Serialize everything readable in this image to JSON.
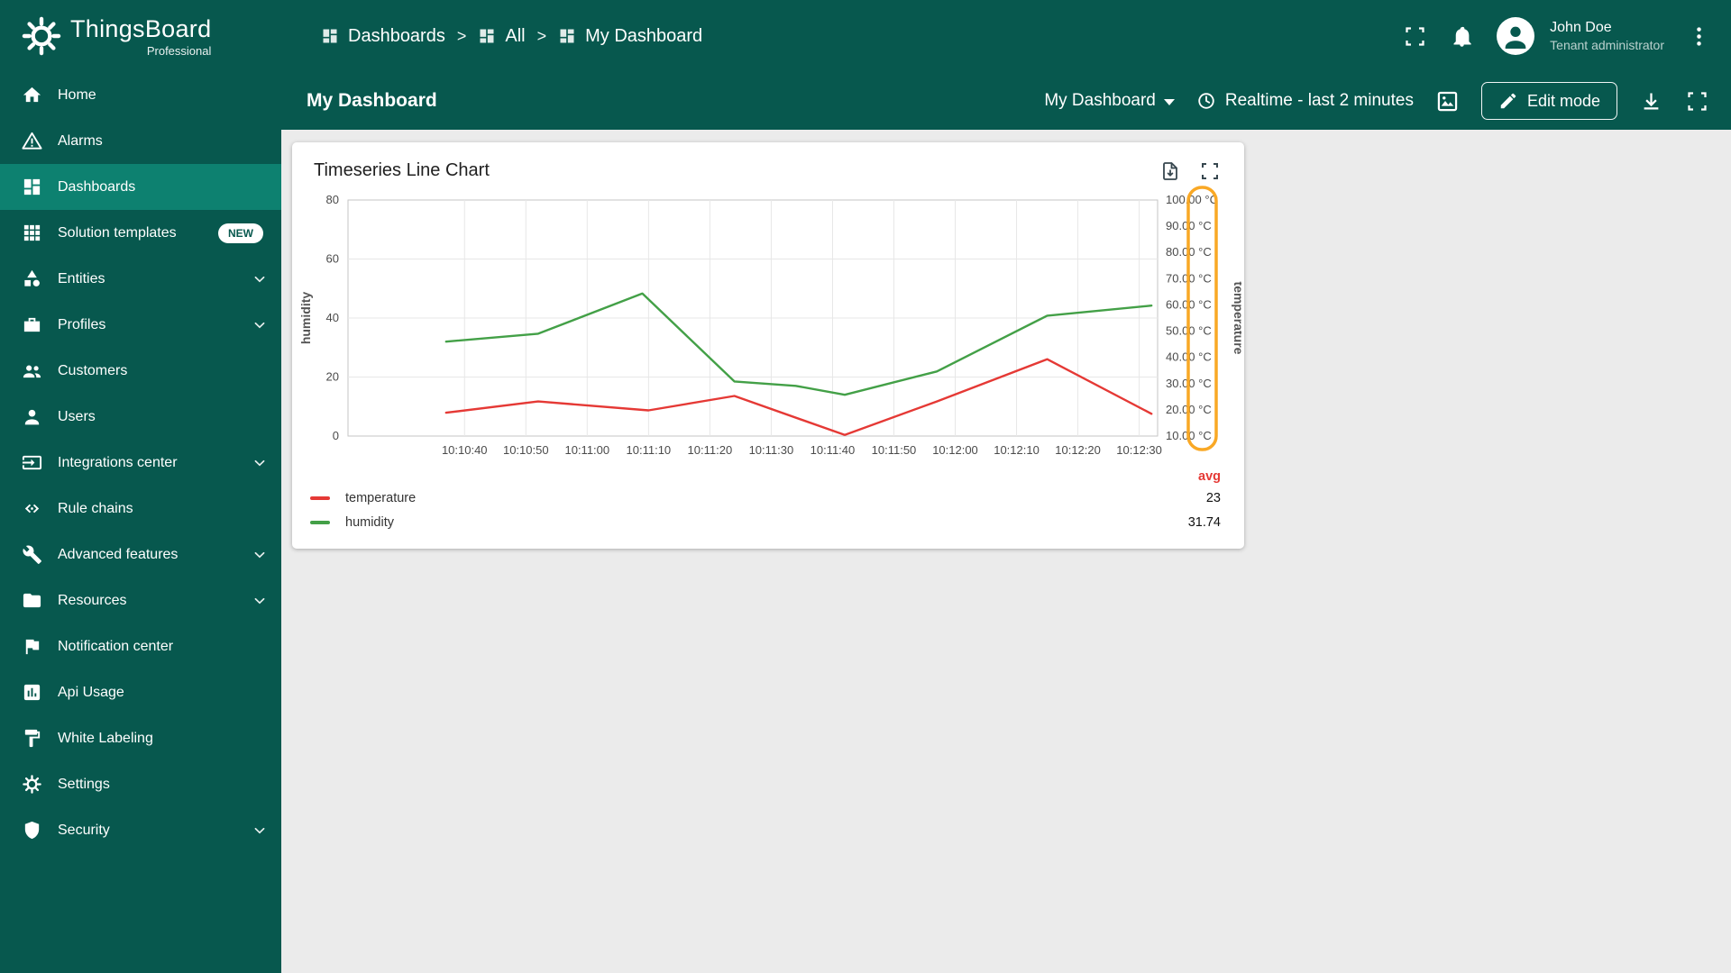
{
  "app": {
    "name": "ThingsBoard",
    "edition": "Professional"
  },
  "colors": {
    "primary": "#07584e",
    "active_item": "#0d8170",
    "highlight": "#f9a825",
    "avg_header": "#e53935"
  },
  "sidebar": {
    "items": [
      {
        "label": "Home",
        "icon": "home"
      },
      {
        "label": "Alarms",
        "icon": "warning"
      },
      {
        "label": "Dashboards",
        "icon": "dashboard",
        "active": true
      },
      {
        "label": "Solution templates",
        "icon": "apps",
        "badge": "NEW"
      },
      {
        "label": "Entities",
        "icon": "category",
        "expandable": true
      },
      {
        "label": "Profiles",
        "icon": "briefcase",
        "expandable": true
      },
      {
        "label": "Customers",
        "icon": "people"
      },
      {
        "label": "Users",
        "icon": "person"
      },
      {
        "label": "Integrations center",
        "icon": "input",
        "expandable": true
      },
      {
        "label": "Rule chains",
        "icon": "rule-chain"
      },
      {
        "label": "Advanced features",
        "icon": "build",
        "expandable": true
      },
      {
        "label": "Resources",
        "icon": "folder",
        "expandable": true
      },
      {
        "label": "Notification center",
        "icon": "flag"
      },
      {
        "label": "Api Usage",
        "icon": "chart-box"
      },
      {
        "label": "White Labeling",
        "icon": "paint"
      },
      {
        "label": "Settings",
        "icon": "gear"
      },
      {
        "label": "Security",
        "icon": "shield",
        "expandable": true
      }
    ]
  },
  "breadcrumb": {
    "separator": ">",
    "items": [
      {
        "label": "Dashboards",
        "icon": "dashboard"
      },
      {
        "label": "All",
        "icon": "dashboard"
      },
      {
        "label": "My Dashboard",
        "icon": "dashboard"
      }
    ]
  },
  "topbar": {
    "user": {
      "name": "John Doe",
      "role": "Tenant administrator"
    },
    "action_icons": [
      "fullscreen",
      "bell",
      "dots"
    ]
  },
  "toolbar": {
    "title": "My Dashboard",
    "dashboard_select": "My Dashboard",
    "timewindow": "Realtime - last 2 minutes",
    "edit_button": "Edit mode",
    "action_icons": [
      "image",
      "download",
      "fullscreen"
    ]
  },
  "widget": {
    "title": "Timeseries Line Chart",
    "action_icons": [
      "export-file",
      "fullscreen"
    ]
  },
  "chart_data": {
    "type": "line",
    "title": "Timeseries Line Chart",
    "x_ticks": [
      "10:10:40",
      "10:10:50",
      "10:11:00",
      "10:11:10",
      "10:11:20",
      "10:11:30",
      "10:11:40",
      "10:11:50",
      "10:12:00",
      "10:12:10",
      "10:12:20",
      "10:12:30"
    ],
    "x_tick_seconds": [
      40,
      50,
      60,
      70,
      80,
      90,
      100,
      110,
      120,
      130,
      140,
      150
    ],
    "x_domain_seconds": [
      21,
      153
    ],
    "left_axis": {
      "title": "humidity",
      "min": 0,
      "max": 80,
      "ticks": [
        0,
        20,
        40,
        60,
        80
      ]
    },
    "right_axis": {
      "title": "temperature",
      "min": 10,
      "max": 100,
      "tick_step": 10,
      "unit": "°C"
    },
    "series": [
      {
        "name": "temperature",
        "color": "#e53935",
        "axis": "right",
        "avg": "23",
        "points": [
          [
            37,
            18.9
          ],
          [
            52,
            23.2
          ],
          [
            70,
            19.8
          ],
          [
            84,
            25.3
          ],
          [
            102,
            10.4
          ],
          [
            117,
            23.2
          ],
          [
            135,
            39.3
          ],
          [
            152,
            18.5
          ]
        ]
      },
      {
        "name": "humidity",
        "color": "#43a047",
        "axis": "left",
        "avg": "31.74",
        "points": [
          [
            37,
            32
          ],
          [
            52,
            34.7
          ],
          [
            69,
            48.3
          ],
          [
            84,
            18.5
          ],
          [
            94,
            17
          ],
          [
            102,
            14
          ],
          [
            117,
            21.9
          ],
          [
            135,
            40.8
          ],
          [
            152,
            44.2
          ]
        ]
      }
    ],
    "legend": {
      "avg_label": "avg"
    },
    "highlight": {
      "target": "right-axis-labels",
      "color": "#f9a825"
    },
    "grid": true,
    "legend_position": "bottom"
  }
}
